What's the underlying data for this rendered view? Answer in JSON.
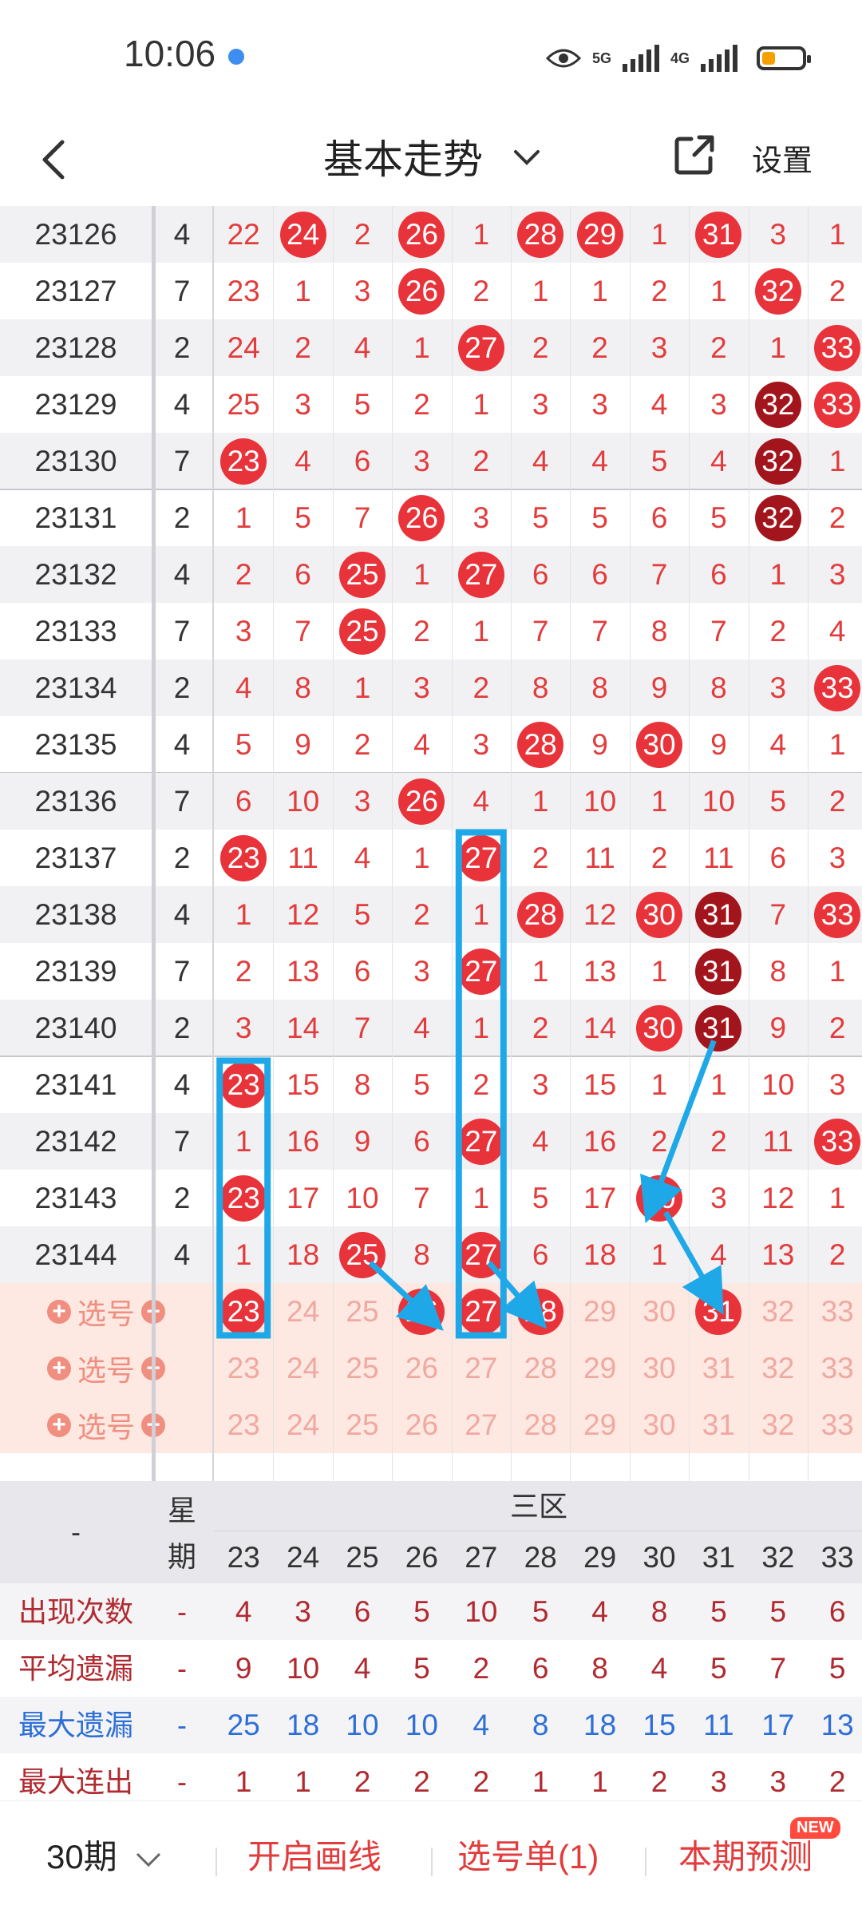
{
  "status_bar": {
    "time": "10:06",
    "network1": "5G",
    "network2": "4G"
  },
  "header": {
    "title": "基本走势",
    "settings": "设置"
  },
  "table": {
    "columns": [
      "23",
      "24",
      "25",
      "26",
      "27",
      "28",
      "29",
      "30",
      "31",
      "32",
      "33"
    ],
    "rows": [
      {
        "issue": "23126",
        "week": "4",
        "cells": [
          {
            "v": "22"
          },
          {
            "v": "24",
            "b": 1
          },
          {
            "v": "2"
          },
          {
            "v": "26",
            "b": 1
          },
          {
            "v": "1"
          },
          {
            "v": "28",
            "b": 1
          },
          {
            "v": "29",
            "b": 1
          },
          {
            "v": "1"
          },
          {
            "v": "31",
            "b": 1
          },
          {
            "v": "3"
          },
          {
            "v": "1"
          }
        ]
      },
      {
        "issue": "23127",
        "week": "7",
        "cells": [
          {
            "v": "23"
          },
          {
            "v": "1"
          },
          {
            "v": "3"
          },
          {
            "v": "26",
            "b": 1
          },
          {
            "v": "2"
          },
          {
            "v": "1"
          },
          {
            "v": "1"
          },
          {
            "v": "2"
          },
          {
            "v": "1"
          },
          {
            "v": "32",
            "b": 1
          },
          {
            "v": "2"
          }
        ]
      },
      {
        "issue": "23128",
        "week": "2",
        "cells": [
          {
            "v": "24"
          },
          {
            "v": "2"
          },
          {
            "v": "4"
          },
          {
            "v": "1"
          },
          {
            "v": "27",
            "b": 1
          },
          {
            "v": "2"
          },
          {
            "v": "2"
          },
          {
            "v": "3"
          },
          {
            "v": "2"
          },
          {
            "v": "1"
          },
          {
            "v": "33",
            "b": 1
          }
        ]
      },
      {
        "issue": "23129",
        "week": "4",
        "cells": [
          {
            "v": "25"
          },
          {
            "v": "3"
          },
          {
            "v": "5"
          },
          {
            "v": "2"
          },
          {
            "v": "1"
          },
          {
            "v": "3"
          },
          {
            "v": "3"
          },
          {
            "v": "4"
          },
          {
            "v": "3"
          },
          {
            "v": "32",
            "b": 2
          },
          {
            "v": "33",
            "b": 1
          }
        ]
      },
      {
        "issue": "23130",
        "week": "7",
        "cells": [
          {
            "v": "23",
            "b": 1
          },
          {
            "v": "4"
          },
          {
            "v": "6"
          },
          {
            "v": "3"
          },
          {
            "v": "2"
          },
          {
            "v": "4"
          },
          {
            "v": "4"
          },
          {
            "v": "5"
          },
          {
            "v": "4"
          },
          {
            "v": "32",
            "b": 2
          },
          {
            "v": "1"
          }
        ]
      },
      {
        "issue": "23131",
        "week": "2",
        "cells": [
          {
            "v": "1"
          },
          {
            "v": "5"
          },
          {
            "v": "7"
          },
          {
            "v": "26",
            "b": 1
          },
          {
            "v": "3"
          },
          {
            "v": "5"
          },
          {
            "v": "5"
          },
          {
            "v": "6"
          },
          {
            "v": "5"
          },
          {
            "v": "32",
            "b": 2
          },
          {
            "v": "2"
          }
        ]
      },
      {
        "issue": "23132",
        "week": "4",
        "cells": [
          {
            "v": "2"
          },
          {
            "v": "6"
          },
          {
            "v": "25",
            "b": 1
          },
          {
            "v": "1"
          },
          {
            "v": "27",
            "b": 1
          },
          {
            "v": "6"
          },
          {
            "v": "6"
          },
          {
            "v": "7"
          },
          {
            "v": "6"
          },
          {
            "v": "1"
          },
          {
            "v": "3"
          }
        ]
      },
      {
        "issue": "23133",
        "week": "7",
        "cells": [
          {
            "v": "3"
          },
          {
            "v": "7"
          },
          {
            "v": "25",
            "b": 1
          },
          {
            "v": "2"
          },
          {
            "v": "1"
          },
          {
            "v": "7"
          },
          {
            "v": "7"
          },
          {
            "v": "8"
          },
          {
            "v": "7"
          },
          {
            "v": "2"
          },
          {
            "v": "4"
          }
        ]
      },
      {
        "issue": "23134",
        "week": "2",
        "cells": [
          {
            "v": "4"
          },
          {
            "v": "8"
          },
          {
            "v": "1"
          },
          {
            "v": "3"
          },
          {
            "v": "2"
          },
          {
            "v": "8"
          },
          {
            "v": "8"
          },
          {
            "v": "9"
          },
          {
            "v": "8"
          },
          {
            "v": "3"
          },
          {
            "v": "33",
            "b": 1
          }
        ]
      },
      {
        "issue": "23135",
        "week": "4",
        "cells": [
          {
            "v": "5"
          },
          {
            "v": "9"
          },
          {
            "v": "2"
          },
          {
            "v": "4"
          },
          {
            "v": "3"
          },
          {
            "v": "28",
            "b": 1
          },
          {
            "v": "9"
          },
          {
            "v": "30",
            "b": 1
          },
          {
            "v": "9"
          },
          {
            "v": "4"
          },
          {
            "v": "1"
          }
        ]
      },
      {
        "issue": "23136",
        "week": "7",
        "cells": [
          {
            "v": "6"
          },
          {
            "v": "10"
          },
          {
            "v": "3"
          },
          {
            "v": "26",
            "b": 1
          },
          {
            "v": "4"
          },
          {
            "v": "1"
          },
          {
            "v": "10"
          },
          {
            "v": "1"
          },
          {
            "v": "10"
          },
          {
            "v": "5"
          },
          {
            "v": "2"
          }
        ]
      },
      {
        "issue": "23137",
        "week": "2",
        "cells": [
          {
            "v": "23",
            "b": 1
          },
          {
            "v": "11"
          },
          {
            "v": "4"
          },
          {
            "v": "1"
          },
          {
            "v": "27",
            "b": 1
          },
          {
            "v": "2"
          },
          {
            "v": "11"
          },
          {
            "v": "2"
          },
          {
            "v": "11"
          },
          {
            "v": "6"
          },
          {
            "v": "3"
          }
        ]
      },
      {
        "issue": "23138",
        "week": "4",
        "cells": [
          {
            "v": "1"
          },
          {
            "v": "12"
          },
          {
            "v": "5"
          },
          {
            "v": "2"
          },
          {
            "v": "1"
          },
          {
            "v": "28",
            "b": 1
          },
          {
            "v": "12"
          },
          {
            "v": "30",
            "b": 1
          },
          {
            "v": "31",
            "b": 2
          },
          {
            "v": "7"
          },
          {
            "v": "33",
            "b": 1
          }
        ]
      },
      {
        "issue": "23139",
        "week": "7",
        "cells": [
          {
            "v": "2"
          },
          {
            "v": "13"
          },
          {
            "v": "6"
          },
          {
            "v": "3"
          },
          {
            "v": "27",
            "b": 1
          },
          {
            "v": "1"
          },
          {
            "v": "13"
          },
          {
            "v": "1"
          },
          {
            "v": "31",
            "b": 2
          },
          {
            "v": "8"
          },
          {
            "v": "1"
          }
        ]
      },
      {
        "issue": "23140",
        "week": "2",
        "cells": [
          {
            "v": "3"
          },
          {
            "v": "14"
          },
          {
            "v": "7"
          },
          {
            "v": "4"
          },
          {
            "v": "1"
          },
          {
            "v": "2"
          },
          {
            "v": "14"
          },
          {
            "v": "30",
            "b": 1
          },
          {
            "v": "31",
            "b": 2
          },
          {
            "v": "9"
          },
          {
            "v": "2"
          }
        ]
      },
      {
        "issue": "23141",
        "week": "4",
        "cells": [
          {
            "v": "23",
            "b": 1
          },
          {
            "v": "15"
          },
          {
            "v": "8"
          },
          {
            "v": "5"
          },
          {
            "v": "2"
          },
          {
            "v": "3"
          },
          {
            "v": "15"
          },
          {
            "v": "1"
          },
          {
            "v": "1"
          },
          {
            "v": "10"
          },
          {
            "v": "3"
          }
        ]
      },
      {
        "issue": "23142",
        "week": "7",
        "cells": [
          {
            "v": "1"
          },
          {
            "v": "16"
          },
          {
            "v": "9"
          },
          {
            "v": "6"
          },
          {
            "v": "27",
            "b": 1
          },
          {
            "v": "4"
          },
          {
            "v": "16"
          },
          {
            "v": "2"
          },
          {
            "v": "2"
          },
          {
            "v": "11"
          },
          {
            "v": "33",
            "b": 1
          }
        ]
      },
      {
        "issue": "23143",
        "week": "2",
        "cells": [
          {
            "v": "23",
            "b": 1
          },
          {
            "v": "17"
          },
          {
            "v": "10"
          },
          {
            "v": "7"
          },
          {
            "v": "1"
          },
          {
            "v": "5"
          },
          {
            "v": "17"
          },
          {
            "v": "30",
            "b": 1
          },
          {
            "v": "3"
          },
          {
            "v": "12"
          },
          {
            "v": "1"
          }
        ]
      },
      {
        "issue": "23144",
        "week": "4",
        "cells": [
          {
            "v": "1"
          },
          {
            "v": "18"
          },
          {
            "v": "25",
            "b": 1
          },
          {
            "v": "8"
          },
          {
            "v": "27",
            "b": 1
          },
          {
            "v": "6"
          },
          {
            "v": "18"
          },
          {
            "v": "1"
          },
          {
            "v": "4"
          },
          {
            "v": "13"
          },
          {
            "v": "2"
          }
        ]
      }
    ],
    "pick_rows": [
      {
        "label": "选号",
        "selected": [
          "23",
          "26",
          "27",
          "28",
          "31"
        ]
      },
      {
        "label": "选号",
        "selected": []
      },
      {
        "label": "选号",
        "selected": []
      }
    ]
  },
  "stats": {
    "zone_label": "三区",
    "dash": "-",
    "week_header_top": "星",
    "week_header_bottom": "期",
    "rows": [
      {
        "label": "出现次数",
        "color": "#b02a30",
        "values": [
          "4",
          "3",
          "6",
          "5",
          "10",
          "5",
          "4",
          "8",
          "5",
          "5",
          "6"
        ]
      },
      {
        "label": "平均遗漏",
        "color": "#b02a30",
        "values": [
          "9",
          "10",
          "4",
          "5",
          "2",
          "6",
          "8",
          "4",
          "5",
          "7",
          "5"
        ]
      },
      {
        "label": "最大遗漏",
        "color": "#2e6fd6",
        "values": [
          "25",
          "18",
          "10",
          "10",
          "4",
          "8",
          "18",
          "15",
          "11",
          "17",
          "13"
        ]
      },
      {
        "label": "最大连出",
        "color": "#b02a30",
        "values": [
          "1",
          "1",
          "2",
          "2",
          "2",
          "1",
          "1",
          "2",
          "3",
          "3",
          "2"
        ]
      }
    ]
  },
  "bottom_bar": {
    "period": "30期",
    "draw": "开启画线",
    "picks": "选号单(1)",
    "predict": "本期预测",
    "new_badge": "NEW"
  },
  "colors": {
    "ball": "#e8333a",
    "ball_dark": "#a3151c",
    "annotation": "#1fa8e8",
    "blue_text": "#2e6fd6"
  }
}
